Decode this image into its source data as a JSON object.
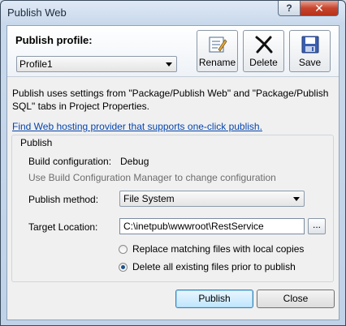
{
  "window": {
    "title": "Publish Web",
    "help_label": "?",
    "close_label": "✕"
  },
  "profile": {
    "heading": "Publish profile:",
    "selected": "Profile1",
    "rename_label": "Rename",
    "delete_label": "Delete",
    "save_label": "Save"
  },
  "description": "Publish uses settings from \"Package/Publish Web\" and \"Package/Publish SQL\" tabs in Project Properties.",
  "hosting_link": "Find Web hosting provider that supports one-click publish.",
  "publish_group": {
    "title": "Publish",
    "build_config_label": "Build configuration:",
    "build_config_value": "Debug",
    "build_config_hint": "Use Build Configuration Manager to change configuration",
    "method_label": "Publish method:",
    "method_value": "File System",
    "target_label": "Target Location:",
    "target_value": "C:\\inetpub\\wwwroot\\RestService",
    "browse_label": "...",
    "option_replace": "Replace matching files with local copies",
    "option_delete": "Delete all existing files prior to publish",
    "selected_option": "delete"
  },
  "footer": {
    "publish_label": "Publish",
    "close_label": "Close"
  },
  "icons": {
    "rename": "rename-icon",
    "delete": "delete-x-icon",
    "save": "floppy-disk-icon",
    "dropdown": "chevron-down-icon"
  },
  "colors": {
    "link": "#0645ad",
    "close_button": "#c7452d",
    "default_button": "#bee6fd"
  }
}
